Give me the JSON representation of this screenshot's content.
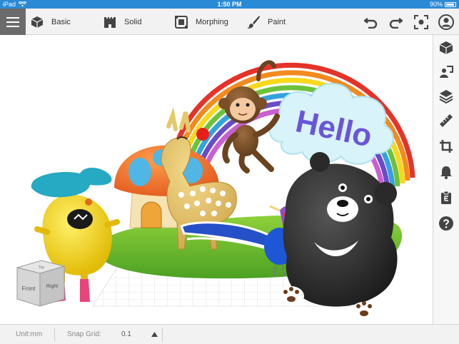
{
  "status_bar": {
    "device": "iPad",
    "time": "1:50 PM",
    "battery": "90%"
  },
  "toolbar": {
    "tools": [
      {
        "label": "Basic",
        "icon": "cube-icon"
      },
      {
        "label": "Solid",
        "icon": "castle-icon"
      },
      {
        "label": "Morphing",
        "icon": "morph-icon"
      },
      {
        "label": "Paint",
        "icon": "paintbrush-icon"
      }
    ],
    "right_icons": [
      "undo-icon",
      "redo-icon",
      "focus-icon",
      "account-icon"
    ]
  },
  "sidebar": {
    "icons": [
      "cube-view-icon",
      "person-model-icon",
      "layers-icon",
      "ruler-icon",
      "crop-icon",
      "bell-icon",
      "clipboard-icon",
      "help-icon"
    ]
  },
  "scene": {
    "hello_text": "Hello",
    "view_cube": {
      "front": "Front",
      "right": "Right",
      "top": "Top"
    }
  },
  "bottom_bar": {
    "unit_label": "Unit:mm",
    "snap_label": "Snap Grid:",
    "snap_value": "0.1"
  },
  "colors": {
    "status_bar": "#2a8ad6",
    "toolbar": "#f2f2f2",
    "menu_button": "#6b6b6b"
  }
}
